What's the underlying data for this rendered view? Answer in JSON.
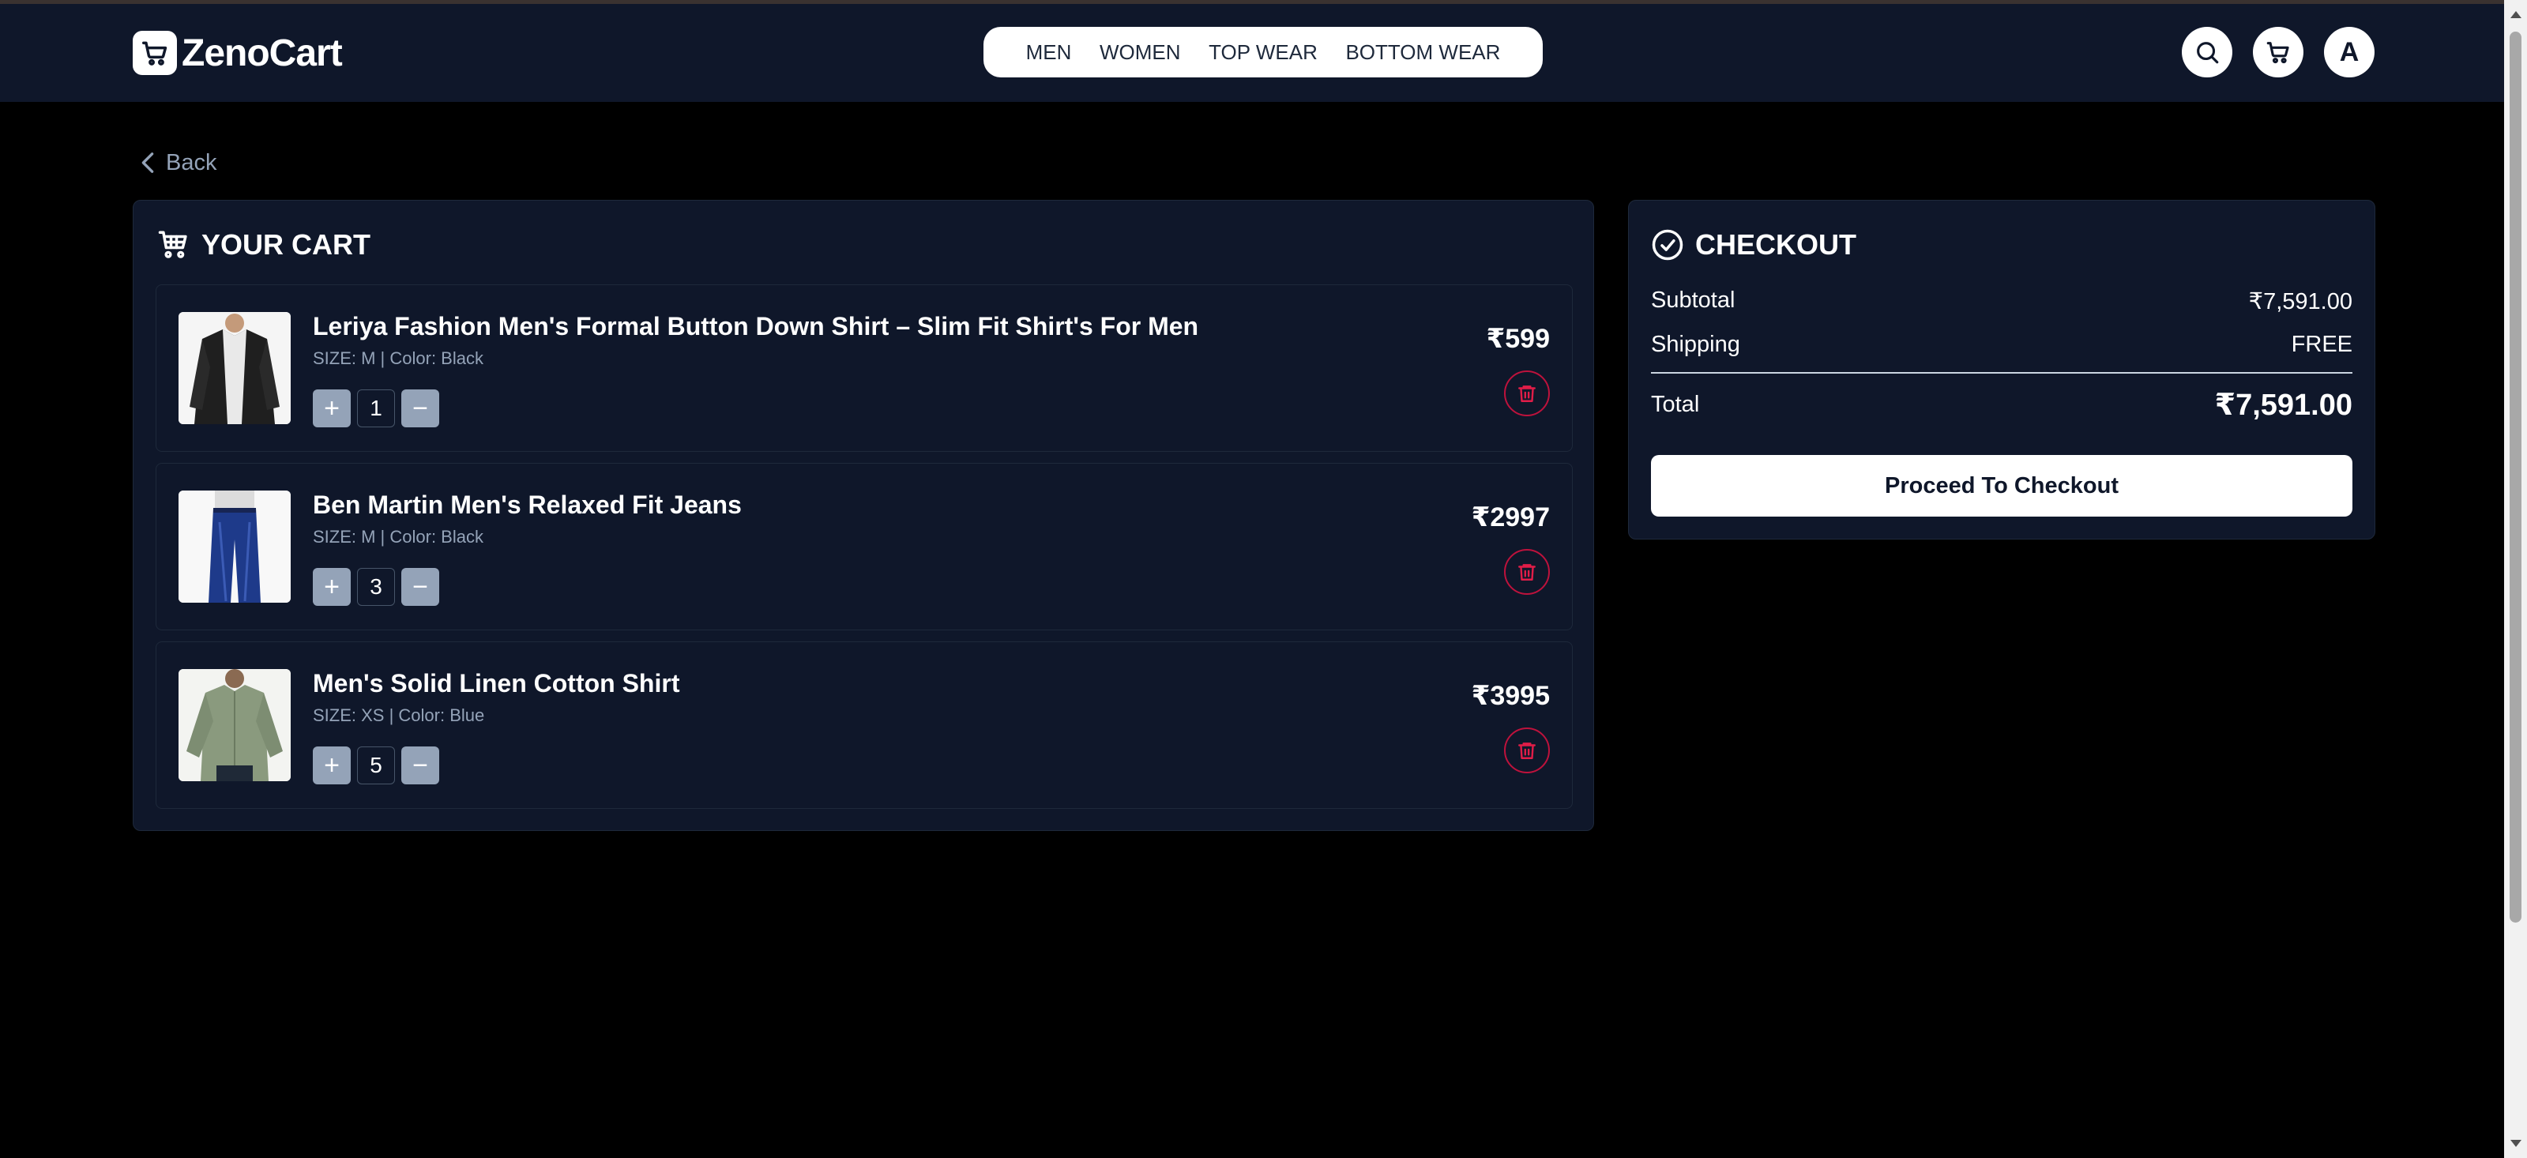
{
  "brand": {
    "name": "ZenoCart"
  },
  "nav": {
    "items": [
      "MEN",
      "WOMEN",
      "TOP WEAR",
      "BOTTOM WEAR"
    ]
  },
  "header": {
    "avatar_initial": "A",
    "icons": [
      "search-icon",
      "cart-icon"
    ]
  },
  "back": {
    "label": "Back"
  },
  "cart": {
    "title": "YOUR CART",
    "items": [
      {
        "name": "Leriya Fashion Men's Formal Button Down Shirt – Slim Fit Shirt's For Men",
        "meta": "SIZE: M | Color: Black",
        "qty": "1",
        "price": "₹599"
      },
      {
        "name": "Ben Martin Men's Relaxed Fit Jeans",
        "meta": "SIZE: M | Color: Black",
        "qty": "3",
        "price": "₹2997"
      },
      {
        "name": "Men's Solid Linen Cotton Shirt",
        "meta": "SIZE: XS | Color: Blue",
        "qty": "5",
        "price": "₹3995"
      }
    ],
    "plus": "+",
    "minus": "−"
  },
  "checkout": {
    "title": "CHECKOUT",
    "subtotal_label": "Subtotal",
    "subtotal_value": "₹7,591.00",
    "shipping_label": "Shipping",
    "shipping_value": "FREE",
    "total_label": "Total",
    "total_value": "₹7,591.00",
    "proceed_label": "Proceed To Checkout"
  },
  "colors": {
    "bg": "#000000",
    "panel": "#0f172a",
    "border": "#1e293b",
    "muted": "#94a3b8",
    "danger": "#be123c"
  }
}
